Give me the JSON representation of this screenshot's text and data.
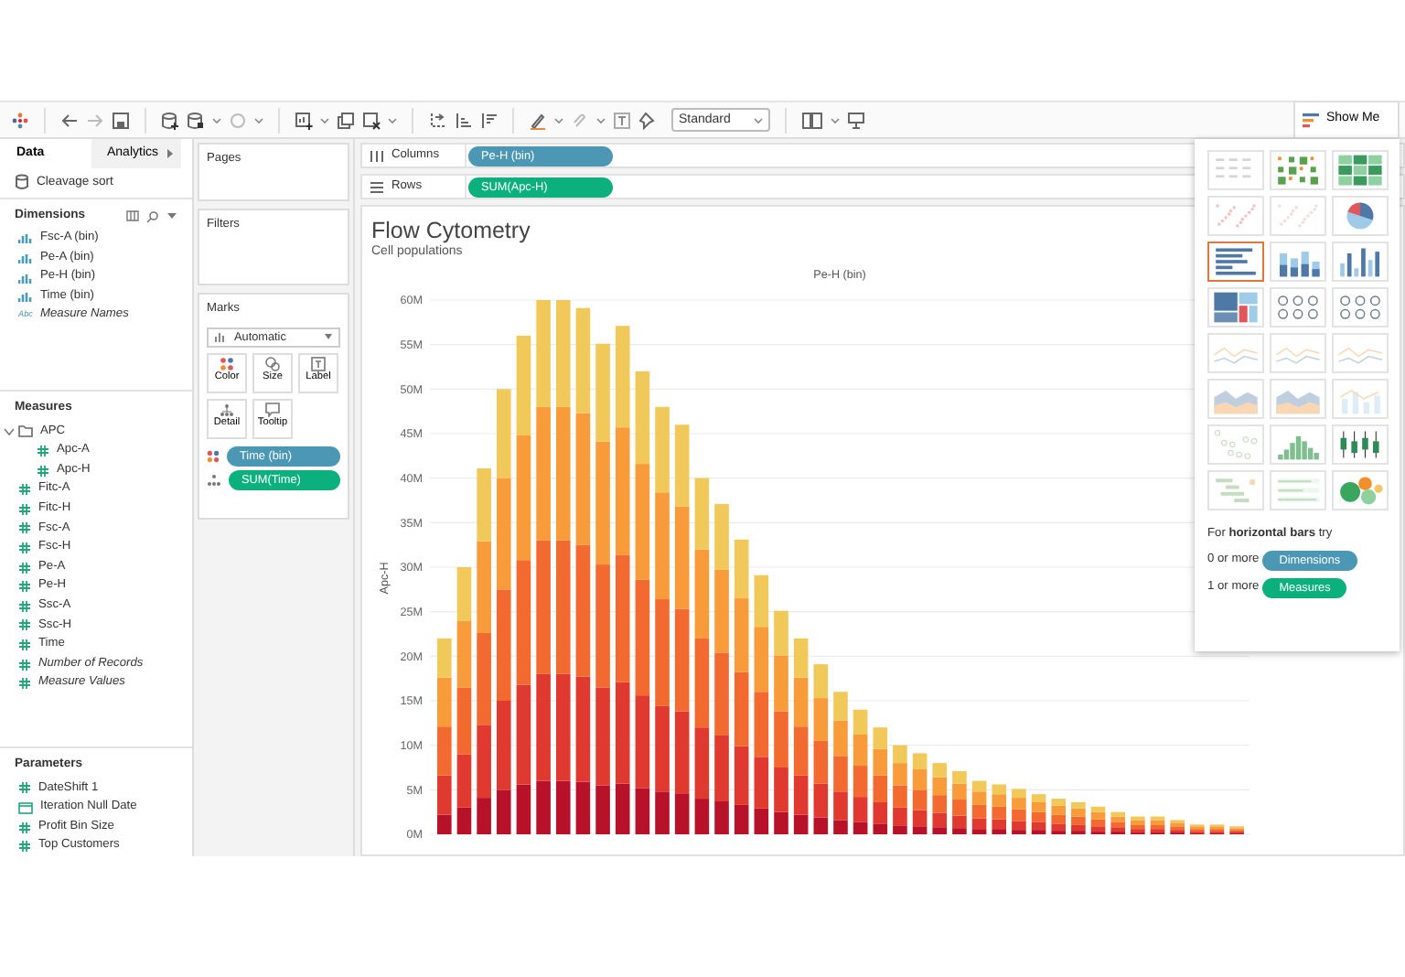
{
  "toolbar": {
    "fit_select": "Standard",
    "show_me_button": {
      "label": "Show Me",
      "selected": true
    }
  },
  "data_pane": {
    "tabs": [
      {
        "label": "Data",
        "selected": true
      },
      {
        "label": "Analytics",
        "selected": false
      }
    ],
    "data_source": "Cleavage sort",
    "dimensions": {
      "title": "Dimensions",
      "items": [
        {
          "label": "Fsc-A (bin)",
          "kind": "bin",
          "italic": false
        },
        {
          "label": "Pe-A (bin)",
          "kind": "bin",
          "italic": false
        },
        {
          "label": "Pe-H (bin)",
          "kind": "bin",
          "italic": false
        },
        {
          "label": "Time (bin)",
          "kind": "bin",
          "italic": false
        },
        {
          "label": "Measure Names",
          "kind": "string",
          "glyph": "Abc",
          "italic": true
        }
      ]
    },
    "measures": {
      "title": "Measures",
      "items": [
        {
          "label": "APC",
          "kind": "folder",
          "italic": false,
          "expanded": true,
          "children": [
            {
              "label": "Apc-A",
              "kind": "measure",
              "italic": false
            },
            {
              "label": "Apc-H",
              "kind": "measure",
              "italic": false
            }
          ]
        },
        {
          "label": "Fitc-A",
          "kind": "measure",
          "italic": false
        },
        {
          "label": "Fitc-H",
          "kind": "measure",
          "italic": false
        },
        {
          "label": "Fsc-A",
          "kind": "measure",
          "italic": false
        },
        {
          "label": "Fsc-H",
          "kind": "measure",
          "italic": false
        },
        {
          "label": "Pe-A",
          "kind": "measure",
          "italic": false
        },
        {
          "label": "Pe-H",
          "kind": "measure",
          "italic": false
        },
        {
          "label": "Ssc-A",
          "kind": "measure",
          "italic": false
        },
        {
          "label": "Ssc-H",
          "kind": "measure",
          "italic": false
        },
        {
          "label": "Time",
          "kind": "measure",
          "italic": false
        },
        {
          "label": "Number of Records",
          "kind": "measure",
          "italic": true
        },
        {
          "label": "Measure Values",
          "kind": "measure",
          "italic": true
        }
      ]
    },
    "parameters": {
      "title": "Parameters",
      "items": [
        {
          "label": "DateShift 1",
          "kind": "measure",
          "italic": false
        },
        {
          "label": "Iteration Null Date",
          "kind": "date",
          "italic": false
        },
        {
          "label": "Profit Bin Size",
          "kind": "measure",
          "italic": false
        },
        {
          "label": "Top Customers",
          "kind": "measure",
          "italic": false
        }
      ]
    }
  },
  "cards": {
    "pages": {
      "title": "Pages"
    },
    "filters": {
      "title": "Filters"
    },
    "marks": {
      "title": "Marks",
      "mark_type": "Automatic",
      "buttons": [
        {
          "label": "Color",
          "kind": "color"
        },
        {
          "label": "Size",
          "kind": "size"
        },
        {
          "label": "Label",
          "kind": "label"
        },
        {
          "label": "Detail",
          "kind": "detail"
        },
        {
          "label": "Tooltip",
          "kind": "tooltip"
        }
      ],
      "pills": [
        {
          "label": "Time (bin)",
          "kind": "color",
          "color": "#4b97b4"
        },
        {
          "label": "SUM(Time)",
          "kind": "detail",
          "color": "#0bb07c"
        }
      ]
    }
  },
  "shelves": [
    {
      "label": "Columns",
      "kind": "columns",
      "pills": [
        {
          "label": "Pe-H (bin)",
          "kind": "discrete"
        }
      ]
    },
    {
      "label": "Rows",
      "kind": "rows",
      "pills": [
        {
          "label": "SUM(Apc-H)",
          "kind": "continuous"
        }
      ]
    }
  ],
  "view": {
    "title": "Flow Cytometry",
    "subtitle": "Cell populations",
    "chart_data": {
      "type": "bar",
      "xlabel": "Pe-H (bin)",
      "ylabel": "Apc-H",
      "stacked": true,
      "orientation": "vertical",
      "grid": true,
      "ylim": [
        0,
        60
      ],
      "yticks": [
        {
          "value": 0,
          "label": "0M"
        },
        {
          "value": 5,
          "label": "5M"
        },
        {
          "value": 10,
          "label": "10M"
        },
        {
          "value": 15,
          "label": "15M"
        },
        {
          "value": 20,
          "label": "20M"
        },
        {
          "value": 25,
          "label": "25M"
        },
        {
          "value": 30,
          "label": "30M"
        },
        {
          "value": 35,
          "label": "35M"
        },
        {
          "value": 40,
          "label": "40M"
        },
        {
          "value": 45,
          "label": "45M"
        },
        {
          "value": 50,
          "label": "50M"
        },
        {
          "value": 55,
          "label": "55M"
        },
        {
          "value": 60,
          "label": "60M"
        }
      ],
      "series": [
        {
          "color": "#b8122b",
          "values": [
            2.2,
            3,
            4.1,
            5,
            5.6,
            6,
            6,
            5.9,
            5.5,
            5.7,
            5.2,
            4.8,
            4.6,
            4,
            3.7,
            3.3,
            2.9,
            2.5,
            2.2,
            1.9,
            1.6,
            1.4,
            1.2,
            1,
            0.9,
            0.8,
            0.7,
            0.6,
            0.6,
            0.5,
            0.5,
            0.4,
            0.4,
            0.3,
            0.3,
            0.2,
            0.2,
            0.2,
            0.1,
            0.1,
            0.1
          ]
        },
        {
          "color": "#e0392f",
          "values": [
            4.4,
            6,
            8.2,
            10,
            11.2,
            12,
            12,
            11.8,
            11,
            11.4,
            10.4,
            9.6,
            9.2,
            8,
            7.4,
            6.6,
            5.8,
            5,
            4.4,
            3.8,
            3.2,
            2.8,
            2.4,
            2,
            1.8,
            1.6,
            1.4,
            1.2,
            1.1,
            1,
            0.9,
            0.8,
            0.7,
            0.6,
            0.5,
            0.4,
            0.4,
            0.3,
            0.2,
            0.2,
            0.2
          ]
        },
        {
          "color": "#f26a2f",
          "values": [
            5.5,
            7.5,
            10.3,
            12.5,
            14,
            15,
            15,
            14.8,
            13.8,
            14.3,
            13,
            12,
            11.5,
            10,
            9.3,
            8.3,
            7.3,
            6.3,
            5.5,
            4.8,
            4,
            3.5,
            3,
            2.5,
            2.3,
            2,
            1.8,
            1.5,
            1.4,
            1.3,
            1.1,
            1,
            0.9,
            0.8,
            0.6,
            0.5,
            0.5,
            0.4,
            0.3,
            0.3,
            0.2
          ]
        },
        {
          "color": "#f89b3a",
          "values": [
            5.5,
            7.5,
            10.3,
            12.5,
            14,
            15,
            15,
            14.8,
            13.8,
            14.3,
            13,
            12,
            11.5,
            10,
            9.3,
            8.3,
            7.3,
            6.3,
            5.5,
            4.8,
            4,
            3.5,
            3,
            2.5,
            2.3,
            2,
            1.8,
            1.5,
            1.4,
            1.3,
            1.1,
            1,
            0.9,
            0.8,
            0.6,
            0.5,
            0.5,
            0.4,
            0.3,
            0.3,
            0.2
          ]
        },
        {
          "color": "#f1c85a",
          "values": [
            4.4,
            6,
            8.2,
            10,
            11.2,
            12,
            12,
            11.8,
            11,
            11.4,
            10.4,
            9.6,
            9.2,
            8,
            7.4,
            6.6,
            5.8,
            5,
            4.4,
            3.8,
            3.2,
            2.8,
            2.4,
            2,
            1.8,
            1.6,
            1.4,
            1.2,
            1.1,
            1,
            0.9,
            0.8,
            0.7,
            0.6,
            0.5,
            0.4,
            0.4,
            0.3,
            0.2,
            0.2,
            0.2
          ]
        }
      ]
    }
  },
  "show_me": {
    "thumbnails": [
      {
        "kind": "text-table",
        "selected": false,
        "disabled": true
      },
      {
        "kind": "heat-map",
        "selected": false,
        "disabled": false
      },
      {
        "kind": "highlight-table",
        "selected": false,
        "disabled": false
      },
      {
        "kind": "symbol-map",
        "selected": false,
        "disabled": true
      },
      {
        "kind": "filled-map",
        "selected": false,
        "disabled": true
      },
      {
        "kind": "pie",
        "selected": false,
        "disabled": false
      },
      {
        "kind": "horizontal-bars",
        "selected": true,
        "disabled": false
      },
      {
        "kind": "stacked-bars",
        "selected": false,
        "disabled": false
      },
      {
        "kind": "side-by-side-bars",
        "selected": false,
        "disabled": false
      },
      {
        "kind": "treemap",
        "selected": false,
        "disabled": false
      },
      {
        "kind": "circle-views",
        "selected": false,
        "disabled": false
      },
      {
        "kind": "side-by-side-circles",
        "selected": false,
        "disabled": false
      },
      {
        "kind": "line-continuous",
        "selected": false,
        "disabled": true
      },
      {
        "kind": "line-discrete",
        "selected": false,
        "disabled": true
      },
      {
        "kind": "dual-line",
        "selected": false,
        "disabled": true
      },
      {
        "kind": "area-continuous",
        "selected": false,
        "disabled": true
      },
      {
        "kind": "area-discrete",
        "selected": false,
        "disabled": true
      },
      {
        "kind": "dual-combination",
        "selected": false,
        "disabled": true
      },
      {
        "kind": "scatter",
        "selected": false,
        "disabled": true
      },
      {
        "kind": "histogram",
        "selected": false,
        "disabled": false
      },
      {
        "kind": "box-whisker",
        "selected": false,
        "disabled": false
      },
      {
        "kind": "gantt",
        "selected": false,
        "disabled": true
      },
      {
        "kind": "bullet",
        "selected": false,
        "disabled": true
      },
      {
        "kind": "packed-bubbles",
        "selected": false,
        "disabled": false
      }
    ],
    "hint": "For **horizontal bars** try",
    "requirements": [
      {
        "count": "0 or more",
        "pill": "Dimensions",
        "kind": "discrete"
      },
      {
        "count": "1 or more",
        "pill": "Measures",
        "kind": "continuous"
      }
    ]
  }
}
